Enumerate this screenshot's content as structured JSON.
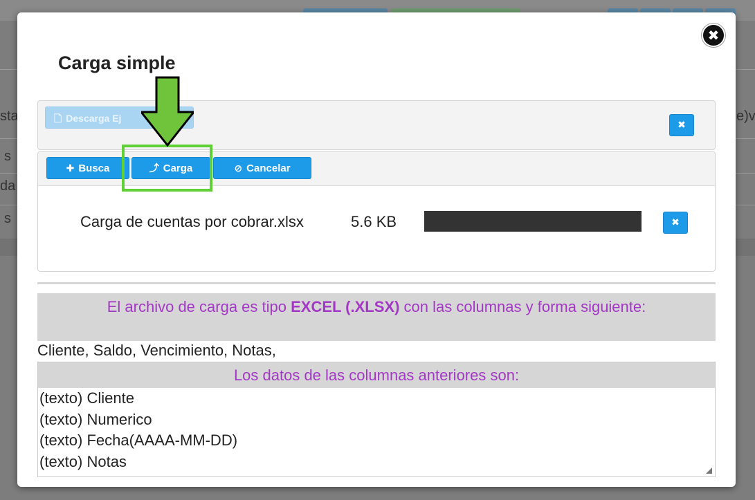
{
  "modal": {
    "title": "Carga simple",
    "close_label": "✖"
  },
  "toolbar": {
    "download_label": "Descarga Ej",
    "browse_label": "Busca",
    "upload_label": "Carga",
    "cancel_label": "Cancelar",
    "clear_label": "✖"
  },
  "file": {
    "name": "Carga de cuentas por cobrar.xlsx",
    "size": "5.6 KB",
    "remove_label": "✖"
  },
  "info": {
    "before": "El archivo de carga es tipo ",
    "emphasis": "EXCEL (.XLSX)",
    "after": " con las columnas y forma siguiente:",
    "columns": "Cliente, Saldo, Vencimiento, Notas,"
  },
  "datatypes": {
    "header": "Los datos de las columnas anteriores son:",
    "lines": [
      "(texto) Cliente",
      "(texto) Numerico",
      "(texto) Fecha(AAAA-MM-DD)",
      "(texto) Notas"
    ]
  },
  "background": {
    "fragments": [
      "sta",
      "s",
      "da",
      "s",
      "e)v"
    ]
  },
  "colors": {
    "accent": "#1e9be8",
    "highlight": "#5fd035",
    "info_text": "#a338c6"
  },
  "icons": {
    "download": "file-icon",
    "browse": "plus-icon",
    "upload": "upload-icon",
    "cancel": "ban-icon",
    "close": "close-icon",
    "annotation": "arrow-down-icon"
  }
}
